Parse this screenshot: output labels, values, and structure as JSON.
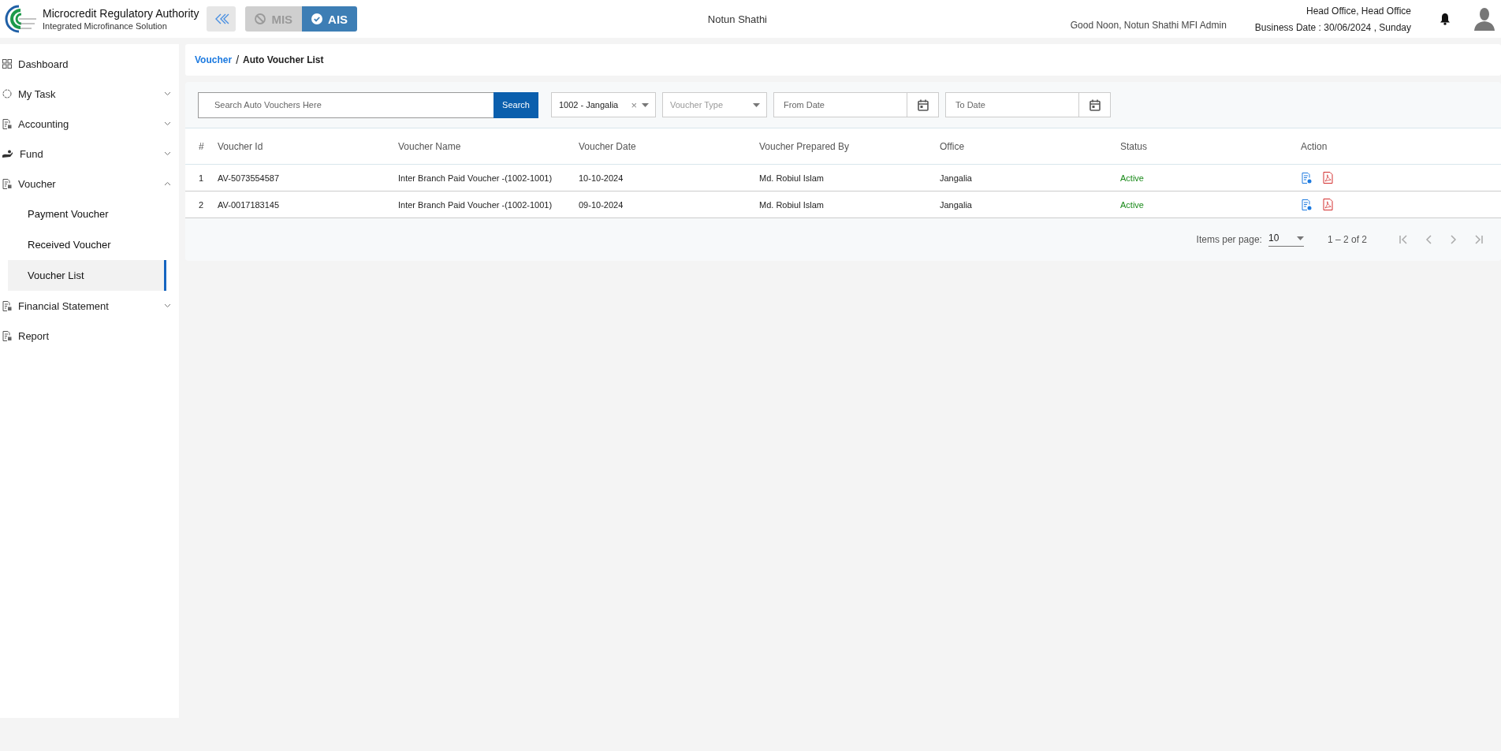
{
  "header": {
    "org_name": "Microcredit Regulatory Authority",
    "org_subtitle": "Integrated Microfinance Solution",
    "modes": [
      {
        "label": "MIS",
        "selected": false
      },
      {
        "label": "AIS",
        "selected": true
      }
    ],
    "center_title": "Notun Shathi",
    "greeting": "Good Noon, Notun Shathi MFI Admin",
    "office": "Head Office, Head Office",
    "business_date": "Business Date : 30/06/2024 , Sunday"
  },
  "sidebar": {
    "items": [
      {
        "label": "Dashboard",
        "kind": "grid"
      },
      {
        "label": "My Task",
        "kind": "circle",
        "expanded": false
      },
      {
        "label": "Accounting",
        "kind": "doc",
        "expanded": false
      },
      {
        "label": "Fund",
        "kind": "hand",
        "expanded": false
      },
      {
        "label": "Voucher",
        "kind": "doc",
        "expanded": true,
        "children": [
          {
            "label": "Payment Voucher",
            "selected": false
          },
          {
            "label": "Received Voucher",
            "selected": false
          },
          {
            "label": "Voucher List",
            "selected": true
          }
        ]
      },
      {
        "label": "Financial Statement",
        "kind": "doc",
        "expanded": false
      },
      {
        "label": "Report",
        "kind": "doc"
      }
    ]
  },
  "breadcrumb": [
    {
      "label": "Voucher",
      "link": true
    },
    {
      "label": "Auto Voucher List",
      "link": false
    }
  ],
  "breadcrumb_separator": "/",
  "filters": {
    "search": {
      "placeholder": "Search Auto Vouchers Here",
      "button": "Search"
    },
    "office_select": {
      "value": "1002 - Jangalia",
      "clear": "×"
    },
    "voucher_type": {
      "placeholder": "Voucher Type"
    },
    "from_date": {
      "placeholder": "From Date"
    },
    "to_date": {
      "placeholder": "To Date"
    }
  },
  "table": {
    "columns": [
      "#",
      "Voucher Id",
      "Voucher Name",
      "Voucher Date",
      "Voucher Prepared By",
      "Office",
      "Status",
      "Action"
    ],
    "rows": [
      {
        "cells": [
          "1",
          "AV-5073554587",
          "Inter Branch Paid Voucher -(1002-1001)",
          "10-10-2024",
          "Md. Robiul Islam",
          "Jangalia",
          "Active"
        ]
      },
      {
        "cells": [
          "2",
          "AV-0017183145",
          "Inter Branch Paid Voucher -(1002-1001)",
          "09-10-2024",
          "Md. Robiul Islam",
          "Jangalia",
          "Active"
        ]
      }
    ]
  },
  "pagination": {
    "items_per_page_label": "Items per page:",
    "items_per_page": "10",
    "range": "1 – 2 of 2",
    "nav": [
      {
        "kind": "first",
        "disabled": true
      },
      {
        "kind": "prev",
        "disabled": true
      },
      {
        "kind": "next",
        "disabled": true
      },
      {
        "kind": "last",
        "disabled": true
      }
    ]
  }
}
